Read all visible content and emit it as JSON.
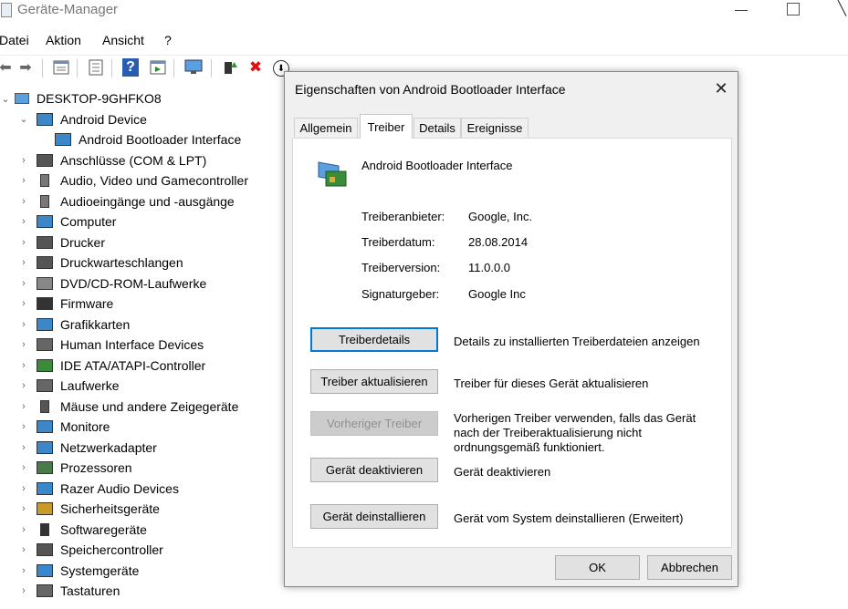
{
  "window": {
    "title": "Geräte-Manager",
    "minimize": "—",
    "close": "╲"
  },
  "menu": [
    "Datei",
    "Aktion",
    "Ansicht",
    "?"
  ],
  "toolbar": {
    "icons": [
      "back-arrow-icon",
      "forward-arrow-icon",
      "properties-icon",
      "list-icon",
      "help-icon",
      "driver-icon",
      "monitor-icon",
      "enable-device-icon",
      "uninstall-icon",
      "update-driver-icon"
    ],
    "uninstall_glyph": "✖",
    "update_glyph": "⬇",
    "help_glyph": "?",
    "back_glyph": "⬅",
    "forward_glyph": "➡"
  },
  "tree": {
    "root": "DESKTOP-9GHFKO8",
    "expanded_glyph": "⌄",
    "collapsed_glyph": "›",
    "items": [
      {
        "label": "Android Device",
        "expanded": true,
        "icon": "android-device-icon",
        "color": "#3a87c9"
      },
      {
        "label": "Android Bootloader Interface",
        "child": true,
        "icon": "network-card-icon",
        "color": "#3a87c9"
      },
      {
        "label": "Anschlüsse (COM & LPT)",
        "icon": "port-icon",
        "color": "#555555"
      },
      {
        "label": "Audio, Video und Gamecontroller",
        "icon": "speaker-icon",
        "color": "#777777"
      },
      {
        "label": "Audioeingänge und -ausgänge",
        "icon": "speaker-icon",
        "color": "#777777"
      },
      {
        "label": "Computer",
        "icon": "computer-icon",
        "color": "#3a87c9"
      },
      {
        "label": "Drucker",
        "icon": "printer-icon",
        "color": "#555555"
      },
      {
        "label": "Druckwarteschlangen",
        "icon": "printer-queue-icon",
        "color": "#555555"
      },
      {
        "label": "DVD/CD-ROM-Laufwerke",
        "icon": "disc-drive-icon",
        "color": "#888888"
      },
      {
        "label": "Firmware",
        "icon": "chip-icon",
        "color": "#333333"
      },
      {
        "label": "Grafikkarten",
        "icon": "graphics-card-icon",
        "color": "#3a87c9"
      },
      {
        "label": "Human Interface Devices",
        "icon": "hid-icon",
        "color": "#666666"
      },
      {
        "label": "IDE ATA/ATAPI-Controller",
        "icon": "ide-controller-icon",
        "color": "#3a8c3a"
      },
      {
        "label": "Laufwerke",
        "icon": "disk-drive-icon",
        "color": "#666666"
      },
      {
        "label": "Mäuse und andere Zeigegeräte",
        "icon": "mouse-icon",
        "color": "#555555"
      },
      {
        "label": "Monitore",
        "icon": "monitor-icon",
        "color": "#3a87c9"
      },
      {
        "label": "Netzwerkadapter",
        "icon": "network-adapter-icon",
        "color": "#3a87c9"
      },
      {
        "label": "Prozessoren",
        "icon": "processor-icon",
        "color": "#4a7a4a"
      },
      {
        "label": "Razer Audio Devices",
        "icon": "razer-audio-icon",
        "color": "#3a87c9"
      },
      {
        "label": "Sicherheitsgeräte",
        "icon": "security-device-icon",
        "color": "#c89a2a"
      },
      {
        "label": "Softwaregeräte",
        "icon": "software-device-icon",
        "color": "#333333"
      },
      {
        "label": "Speichercontroller",
        "icon": "storage-controller-icon",
        "color": "#555555"
      },
      {
        "label": "Systemgeräte",
        "icon": "system-device-icon",
        "color": "#3a87c9"
      },
      {
        "label": "Tastaturen",
        "icon": "keyboard-icon",
        "color": "#666666"
      }
    ]
  },
  "dialog": {
    "title": "Eigenschaften von Android Bootloader Interface",
    "close": "✕",
    "tabs": [
      "Allgemein",
      "Treiber",
      "Details",
      "Ereignisse"
    ],
    "active_tab": "Treiber",
    "device_name": "Android Bootloader Interface",
    "properties": [
      {
        "label": "Treiberanbieter:",
        "value": "Google, Inc."
      },
      {
        "label": "Treiberdatum:",
        "value": "28.08.2014"
      },
      {
        "label": "Treiberversion:",
        "value": "11.0.0.0"
      },
      {
        "label": "Signaturgeber:",
        "value": "Google Inc"
      }
    ],
    "buttons": [
      {
        "label": "Treiberdetails",
        "desc": "Details zu installierten Treiberdateien anzeigen"
      },
      {
        "label": "Treiber aktualisieren",
        "desc": "Treiber für dieses Gerät aktualisieren"
      },
      {
        "label": "Vorheriger Treiber",
        "desc": "Vorherigen Treiber verwenden, falls das Gerät nach der Treiberaktualisierung nicht ordnungsgemäß funktioniert.",
        "disabled": true
      },
      {
        "label": "Gerät deaktivieren",
        "desc": "Gerät deaktivieren"
      },
      {
        "label": "Gerät deinstallieren",
        "desc": "Gerät vom System deinstallieren (Erweitert)"
      }
    ],
    "ok": "OK",
    "cancel": "Abbrechen"
  }
}
